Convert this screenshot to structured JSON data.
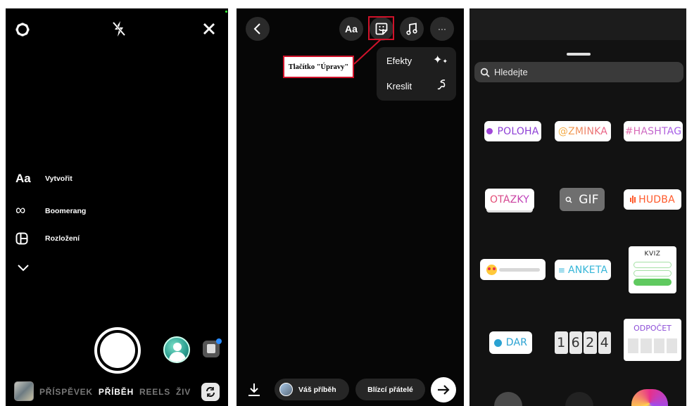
{
  "camera": {
    "side_menu": [
      {
        "icon": "text-aa-icon",
        "glyph": "Aa",
        "label": "Vytvořit"
      },
      {
        "icon": "boomerang-icon",
        "glyph": "∞",
        "label": "Boomerang"
      },
      {
        "icon": "layout-icon",
        "glyph": "",
        "label": "Rozložení"
      }
    ],
    "modes": [
      "PŘÍSPĚVEK",
      "PŘÍBĚH",
      "REELS",
      "ŽIV"
    ],
    "active_mode": "PŘÍBĚH"
  },
  "editor": {
    "text_tool": "Aa",
    "more": "···",
    "menu": [
      {
        "label": "Efekty",
        "icon": "sparkles-icon"
      },
      {
        "label": "Kreslit",
        "icon": "squiggle-icon"
      }
    ],
    "annotation": "Tlačítko \"Úpravy\"",
    "your_story": "Váš příběh",
    "close_friends": "Blízcí přátelé",
    "highlight_color": "#d0122a"
  },
  "stickers": {
    "search_placeholder": "Hledejte",
    "items": {
      "location": "POLOHA",
      "mention": "@ZMÍNKA",
      "hashtag": "#HASHTAG",
      "questions": "OTÁZKY",
      "gif": "GIF",
      "music": "HUDBA",
      "poll": "ANKETA",
      "quiz": "KVIZ",
      "donate": "DAR",
      "time": [
        "1",
        "6",
        "2",
        "4"
      ],
      "countdown": "ODPOČET"
    }
  }
}
